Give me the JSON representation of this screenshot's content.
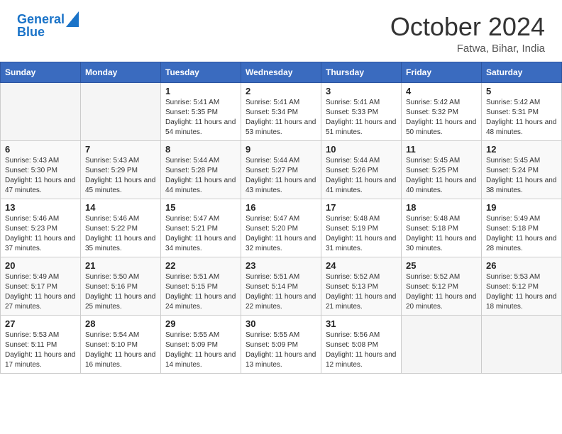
{
  "header": {
    "logo_line1": "General",
    "logo_line2": "Blue",
    "month": "October 2024",
    "location": "Fatwa, Bihar, India"
  },
  "weekdays": [
    "Sunday",
    "Monday",
    "Tuesday",
    "Wednesday",
    "Thursday",
    "Friday",
    "Saturday"
  ],
  "weeks": [
    [
      {
        "day": "",
        "sunrise": "",
        "sunset": "",
        "daylight": ""
      },
      {
        "day": "",
        "sunrise": "",
        "sunset": "",
        "daylight": ""
      },
      {
        "day": "1",
        "sunrise": "Sunrise: 5:41 AM",
        "sunset": "Sunset: 5:35 PM",
        "daylight": "Daylight: 11 hours and 54 minutes."
      },
      {
        "day": "2",
        "sunrise": "Sunrise: 5:41 AM",
        "sunset": "Sunset: 5:34 PM",
        "daylight": "Daylight: 11 hours and 53 minutes."
      },
      {
        "day": "3",
        "sunrise": "Sunrise: 5:41 AM",
        "sunset": "Sunset: 5:33 PM",
        "daylight": "Daylight: 11 hours and 51 minutes."
      },
      {
        "day": "4",
        "sunrise": "Sunrise: 5:42 AM",
        "sunset": "Sunset: 5:32 PM",
        "daylight": "Daylight: 11 hours and 50 minutes."
      },
      {
        "day": "5",
        "sunrise": "Sunrise: 5:42 AM",
        "sunset": "Sunset: 5:31 PM",
        "daylight": "Daylight: 11 hours and 48 minutes."
      }
    ],
    [
      {
        "day": "6",
        "sunrise": "Sunrise: 5:43 AM",
        "sunset": "Sunset: 5:30 PM",
        "daylight": "Daylight: 11 hours and 47 minutes."
      },
      {
        "day": "7",
        "sunrise": "Sunrise: 5:43 AM",
        "sunset": "Sunset: 5:29 PM",
        "daylight": "Daylight: 11 hours and 45 minutes."
      },
      {
        "day": "8",
        "sunrise": "Sunrise: 5:44 AM",
        "sunset": "Sunset: 5:28 PM",
        "daylight": "Daylight: 11 hours and 44 minutes."
      },
      {
        "day": "9",
        "sunrise": "Sunrise: 5:44 AM",
        "sunset": "Sunset: 5:27 PM",
        "daylight": "Daylight: 11 hours and 43 minutes."
      },
      {
        "day": "10",
        "sunrise": "Sunrise: 5:44 AM",
        "sunset": "Sunset: 5:26 PM",
        "daylight": "Daylight: 11 hours and 41 minutes."
      },
      {
        "day": "11",
        "sunrise": "Sunrise: 5:45 AM",
        "sunset": "Sunset: 5:25 PM",
        "daylight": "Daylight: 11 hours and 40 minutes."
      },
      {
        "day": "12",
        "sunrise": "Sunrise: 5:45 AM",
        "sunset": "Sunset: 5:24 PM",
        "daylight": "Daylight: 11 hours and 38 minutes."
      }
    ],
    [
      {
        "day": "13",
        "sunrise": "Sunrise: 5:46 AM",
        "sunset": "Sunset: 5:23 PM",
        "daylight": "Daylight: 11 hours and 37 minutes."
      },
      {
        "day": "14",
        "sunrise": "Sunrise: 5:46 AM",
        "sunset": "Sunset: 5:22 PM",
        "daylight": "Daylight: 11 hours and 35 minutes."
      },
      {
        "day": "15",
        "sunrise": "Sunrise: 5:47 AM",
        "sunset": "Sunset: 5:21 PM",
        "daylight": "Daylight: 11 hours and 34 minutes."
      },
      {
        "day": "16",
        "sunrise": "Sunrise: 5:47 AM",
        "sunset": "Sunset: 5:20 PM",
        "daylight": "Daylight: 11 hours and 32 minutes."
      },
      {
        "day": "17",
        "sunrise": "Sunrise: 5:48 AM",
        "sunset": "Sunset: 5:19 PM",
        "daylight": "Daylight: 11 hours and 31 minutes."
      },
      {
        "day": "18",
        "sunrise": "Sunrise: 5:48 AM",
        "sunset": "Sunset: 5:18 PM",
        "daylight": "Daylight: 11 hours and 30 minutes."
      },
      {
        "day": "19",
        "sunrise": "Sunrise: 5:49 AM",
        "sunset": "Sunset: 5:18 PM",
        "daylight": "Daylight: 11 hours and 28 minutes."
      }
    ],
    [
      {
        "day": "20",
        "sunrise": "Sunrise: 5:49 AM",
        "sunset": "Sunset: 5:17 PM",
        "daylight": "Daylight: 11 hours and 27 minutes."
      },
      {
        "day": "21",
        "sunrise": "Sunrise: 5:50 AM",
        "sunset": "Sunset: 5:16 PM",
        "daylight": "Daylight: 11 hours and 25 minutes."
      },
      {
        "day": "22",
        "sunrise": "Sunrise: 5:51 AM",
        "sunset": "Sunset: 5:15 PM",
        "daylight": "Daylight: 11 hours and 24 minutes."
      },
      {
        "day": "23",
        "sunrise": "Sunrise: 5:51 AM",
        "sunset": "Sunset: 5:14 PM",
        "daylight": "Daylight: 11 hours and 22 minutes."
      },
      {
        "day": "24",
        "sunrise": "Sunrise: 5:52 AM",
        "sunset": "Sunset: 5:13 PM",
        "daylight": "Daylight: 11 hours and 21 minutes."
      },
      {
        "day": "25",
        "sunrise": "Sunrise: 5:52 AM",
        "sunset": "Sunset: 5:12 PM",
        "daylight": "Daylight: 11 hours and 20 minutes."
      },
      {
        "day": "26",
        "sunrise": "Sunrise: 5:53 AM",
        "sunset": "Sunset: 5:12 PM",
        "daylight": "Daylight: 11 hours and 18 minutes."
      }
    ],
    [
      {
        "day": "27",
        "sunrise": "Sunrise: 5:53 AM",
        "sunset": "Sunset: 5:11 PM",
        "daylight": "Daylight: 11 hours and 17 minutes."
      },
      {
        "day": "28",
        "sunrise": "Sunrise: 5:54 AM",
        "sunset": "Sunset: 5:10 PM",
        "daylight": "Daylight: 11 hours and 16 minutes."
      },
      {
        "day": "29",
        "sunrise": "Sunrise: 5:55 AM",
        "sunset": "Sunset: 5:09 PM",
        "daylight": "Daylight: 11 hours and 14 minutes."
      },
      {
        "day": "30",
        "sunrise": "Sunrise: 5:55 AM",
        "sunset": "Sunset: 5:09 PM",
        "daylight": "Daylight: 11 hours and 13 minutes."
      },
      {
        "day": "31",
        "sunrise": "Sunrise: 5:56 AM",
        "sunset": "Sunset: 5:08 PM",
        "daylight": "Daylight: 11 hours and 12 minutes."
      },
      {
        "day": "",
        "sunrise": "",
        "sunset": "",
        "daylight": ""
      },
      {
        "day": "",
        "sunrise": "",
        "sunset": "",
        "daylight": ""
      }
    ]
  ]
}
